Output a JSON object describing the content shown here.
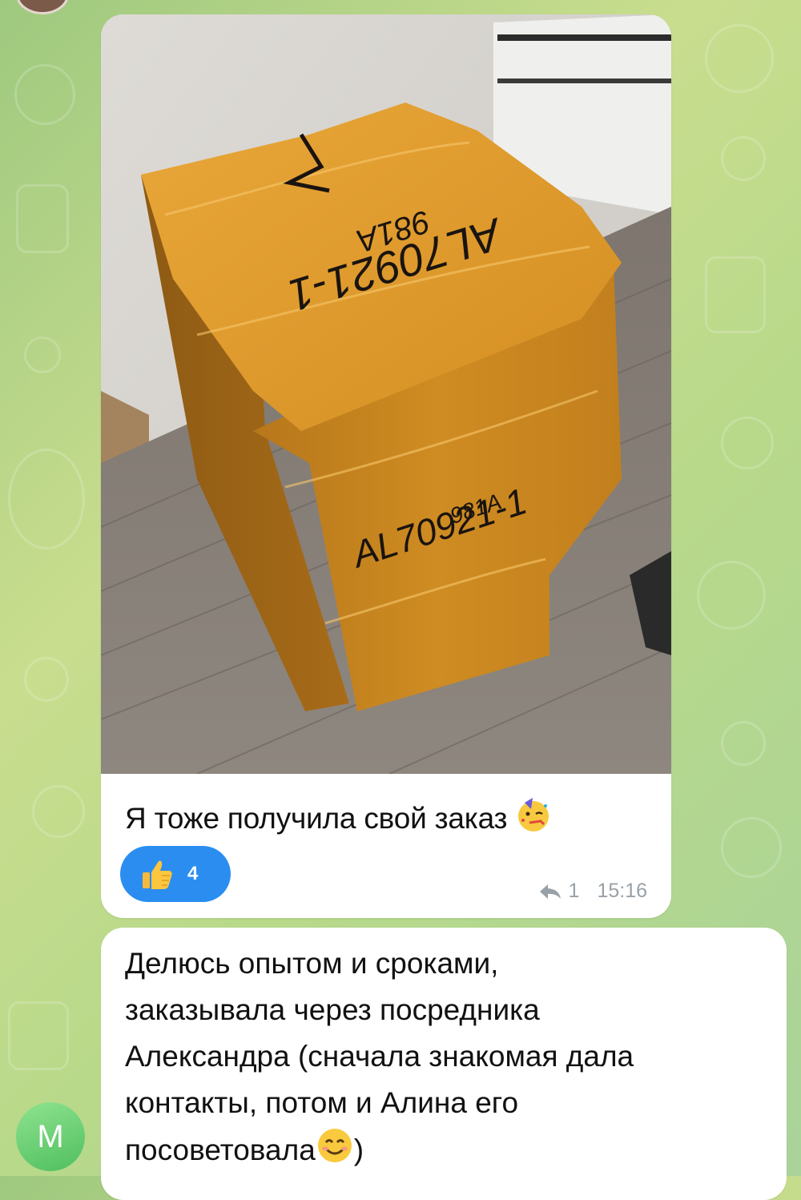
{
  "messages": [
    {
      "type": "photo",
      "photo": {
        "description_icon": "package-photo",
        "box_label_top": "AL70921-1",
        "box_label_top_sub": "981A",
        "box_label_side": "AL70921-1",
        "box_label_side_sub": "981A"
      },
      "caption": "Я тоже получила свой заказ",
      "caption_emoji": "partying-face-emoji",
      "reaction": {
        "emoji": "thumbs-up-emoji",
        "count": "4"
      },
      "replies": "1",
      "time": "15:16"
    },
    {
      "type": "text",
      "lines": [
        "Делюсь опытом и сроками,",
        "заказывала через посредника",
        "Александра (сначала знакомая дала",
        "контакты, потом и Алина его",
        "посоветовала",
        ")"
      ],
      "emoji": "smiling-face-emoji",
      "sender_initial": "М"
    }
  ],
  "colors": {
    "reaction_bg": "#2b8df0",
    "meta_text": "#98a1a7",
    "avatar_green": "#4fbf5f",
    "wallpaper": "#b8d98a"
  }
}
